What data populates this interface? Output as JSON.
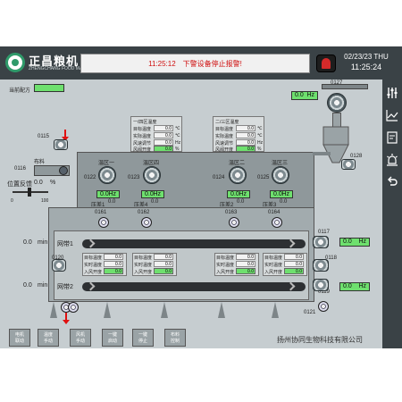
{
  "header": {
    "logo_brand": "正昌粮机",
    "logo_sub": "ZHENGCHANG FOOD MACHINERY",
    "alarm_time": "11:25:12",
    "alarm_text": "下警设备停止报警!",
    "date": "02/23/23 THU",
    "time": "11:25:24"
  },
  "sidebar_icons": [
    "sliders-icon",
    "trend-icon",
    "report-icon",
    "alarm-light-icon",
    "back-icon"
  ],
  "recipe": {
    "label": "当前配方",
    "value": ""
  },
  "left": {
    "feed_label": "布料",
    "position_label": "位置反馈",
    "position_value": "0.0",
    "position_unit": "%",
    "slider_min": "0",
    "slider_max": "100",
    "valve_0115": "0115",
    "valve_0116": "0116"
  },
  "fans_top": [
    {
      "tag": "0122",
      "title": "温区一",
      "hz": "0.0",
      "unit": "Hz",
      "pressure_label": "压差1",
      "pressure_value": "0.0"
    },
    {
      "tag": "0123",
      "title": "温区四",
      "hz": "0.0",
      "unit": "Hz",
      "pressure_label": "压差4",
      "pressure_value": "0.0"
    },
    {
      "tag": "0124",
      "title": "温区二",
      "hz": "0.0",
      "unit": "Hz",
      "pressure_label": "压差2",
      "pressure_value": "0.0"
    },
    {
      "tag": "0125",
      "title": "温区三",
      "hz": "0.0",
      "unit": "Hz",
      "pressure_label": "压差3",
      "pressure_value": "0.0"
    }
  ],
  "panels_top": [
    {
      "title": "一/四区温度",
      "rows": [
        {
          "label": "目标温度",
          "value": "0.0",
          "unit": "℃"
        },
        {
          "label": "实际温度",
          "value": "0.0",
          "unit": "℃"
        },
        {
          "label": "风速调节",
          "value": "0.0",
          "unit": "Hz"
        },
        {
          "label": "风阀开度",
          "value": "0.0",
          "unit": "%"
        }
      ]
    },
    {
      "title": "二/三区温度",
      "rows": [
        {
          "label": "目标温度",
          "value": "0.0",
          "unit": "℃"
        },
        {
          "label": "实际温度",
          "value": "0.0",
          "unit": "℃"
        },
        {
          "label": "风速调节",
          "value": "0.0",
          "unit": "Hz"
        },
        {
          "label": "风阀开度",
          "value": "0.0",
          "unit": "%"
        }
      ]
    }
  ],
  "small_fans": [
    {
      "tag": "0161"
    },
    {
      "tag": "0162"
    },
    {
      "tag": "0163"
    },
    {
      "tag": "0164"
    }
  ],
  "layers": [
    {
      "label": "网带1",
      "time": "0.0",
      "unit": "min"
    },
    {
      "label": "网带2",
      "time": "0.0",
      "unit": "min"
    }
  ],
  "panels_bottom": [
    {
      "rows": [
        {
          "label": "目标温度",
          "value": "0.0",
          "unit": "℃"
        },
        {
          "label": "实时温度",
          "value": "0.0",
          "unit": "℃"
        },
        {
          "label": "入风开度",
          "value": "0.0",
          "unit": "%"
        }
      ]
    },
    {
      "rows": [
        {
          "label": "目标温度",
          "value": "0.0",
          "unit": "℃"
        },
        {
          "label": "实时温度",
          "value": "0.0",
          "unit": "℃"
        },
        {
          "label": "入风开度",
          "value": "0.0",
          "unit": "%"
        }
      ]
    },
    {
      "rows": [
        {
          "label": "目标温度",
          "value": "0.0",
          "unit": "℃"
        },
        {
          "label": "实时温度",
          "value": "0.0",
          "unit": "℃"
        },
        {
          "label": "入风开度",
          "value": "0.0",
          "unit": "%"
        }
      ]
    },
    {
      "rows": [
        {
          "label": "目标温度",
          "value": "0.0",
          "unit": "℃"
        },
        {
          "label": "实时温度",
          "value": "0.0",
          "unit": "℃"
        },
        {
          "label": "入风开度",
          "value": "0.0",
          "unit": "%"
        }
      ]
    }
  ],
  "right": {
    "cyclone_tag": "0127",
    "cyclone_hz": "0.0",
    "cyclone_unit": "Hz",
    "fan_0128": "0128",
    "fan_0117": "0117",
    "fan_0117_hz": "0.0",
    "fan_0118": "0118",
    "fan_0119": "0119",
    "fan_0119_hz": "0.0",
    "hz_unit": "Hz"
  },
  "bottom_tags": {
    "left": "0120",
    "discharge": "0121"
  },
  "buttons": [
    {
      "l1": "电机",
      "l2": "联动"
    },
    {
      "l1": "温度",
      "l2": "手动"
    },
    {
      "l1": "风机",
      "l2": "手动"
    },
    {
      "l1": "一键",
      "l2": "启动"
    },
    {
      "l1": "一键",
      "l2": "停止"
    },
    {
      "l1": "布料",
      "l2": "控制"
    }
  ],
  "company": "扬州协同生物科技有限公司",
  "colors": {
    "topbar": "#3a4246",
    "screen": "#c6cdd0",
    "indicator": "#6ee06e",
    "alarm_text": "#d01010"
  }
}
